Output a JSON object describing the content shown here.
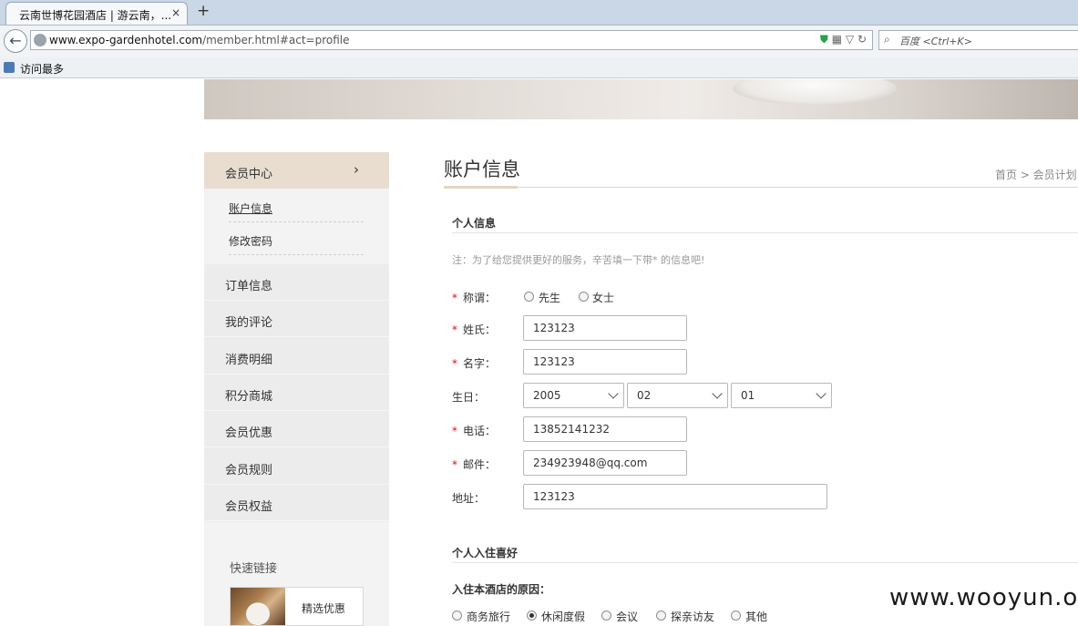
{
  "browser": {
    "tab_title": "云南世博花园酒店 | 游云南，...",
    "tab_close": "×",
    "new_tab": "+",
    "back_glyph": "←",
    "url_domain": "www.expo-gardenhotel.com",
    "url_path": "/member.html#act=profile",
    "url_icons": "▦ ▽ ↻",
    "search_placeholder": "百度 <Ctrl+K>",
    "bookmark_label": "访问最多"
  },
  "sidebar": {
    "header": "会员中心",
    "header_chevron": "›",
    "sub_items": [
      {
        "label": "账户信息"
      },
      {
        "label": "修改密码"
      }
    ],
    "items": [
      {
        "label": "订单信息"
      },
      {
        "label": "我的评论"
      },
      {
        "label": "消费明细"
      },
      {
        "label": "积分商城"
      },
      {
        "label": "会员优惠"
      },
      {
        "label": "会员规则"
      },
      {
        "label": "会员权益"
      }
    ],
    "quick_links_title": "快速链接",
    "quick_link_label": "精选优惠"
  },
  "main": {
    "title": "账户信息",
    "breadcrumb": "首页 > 会员计划 >",
    "section1_title": "个人信息",
    "note": "注：为了给您提供更好的服务，辛苦填一下带* 的信息吧!",
    "required_mark": "*",
    "fields": {
      "salutation_label": "称谓：",
      "salutation_options": [
        "先生",
        "女士"
      ],
      "surname_label": "姓氏：",
      "surname_value": "123123",
      "name_label": "名字：",
      "name_value": "123123",
      "birthday_label": "生日：",
      "birthday_year": "2005",
      "birthday_month": "02",
      "birthday_day": "01",
      "phone_label": "电话：",
      "phone_value": "13852141232",
      "email_label": "邮件：",
      "email_value": "234923948@qq.com",
      "address_label": "地址：",
      "address_value": "123123"
    },
    "section2_title": "个人入住喜好",
    "reason_label": "入住本酒店的原因：",
    "reasons": [
      "商务旅行",
      "休闲度假",
      "会议",
      "探亲访友",
      "其他"
    ],
    "reason_selected": "休闲度假"
  },
  "watermark": "www.wooyun.org"
}
